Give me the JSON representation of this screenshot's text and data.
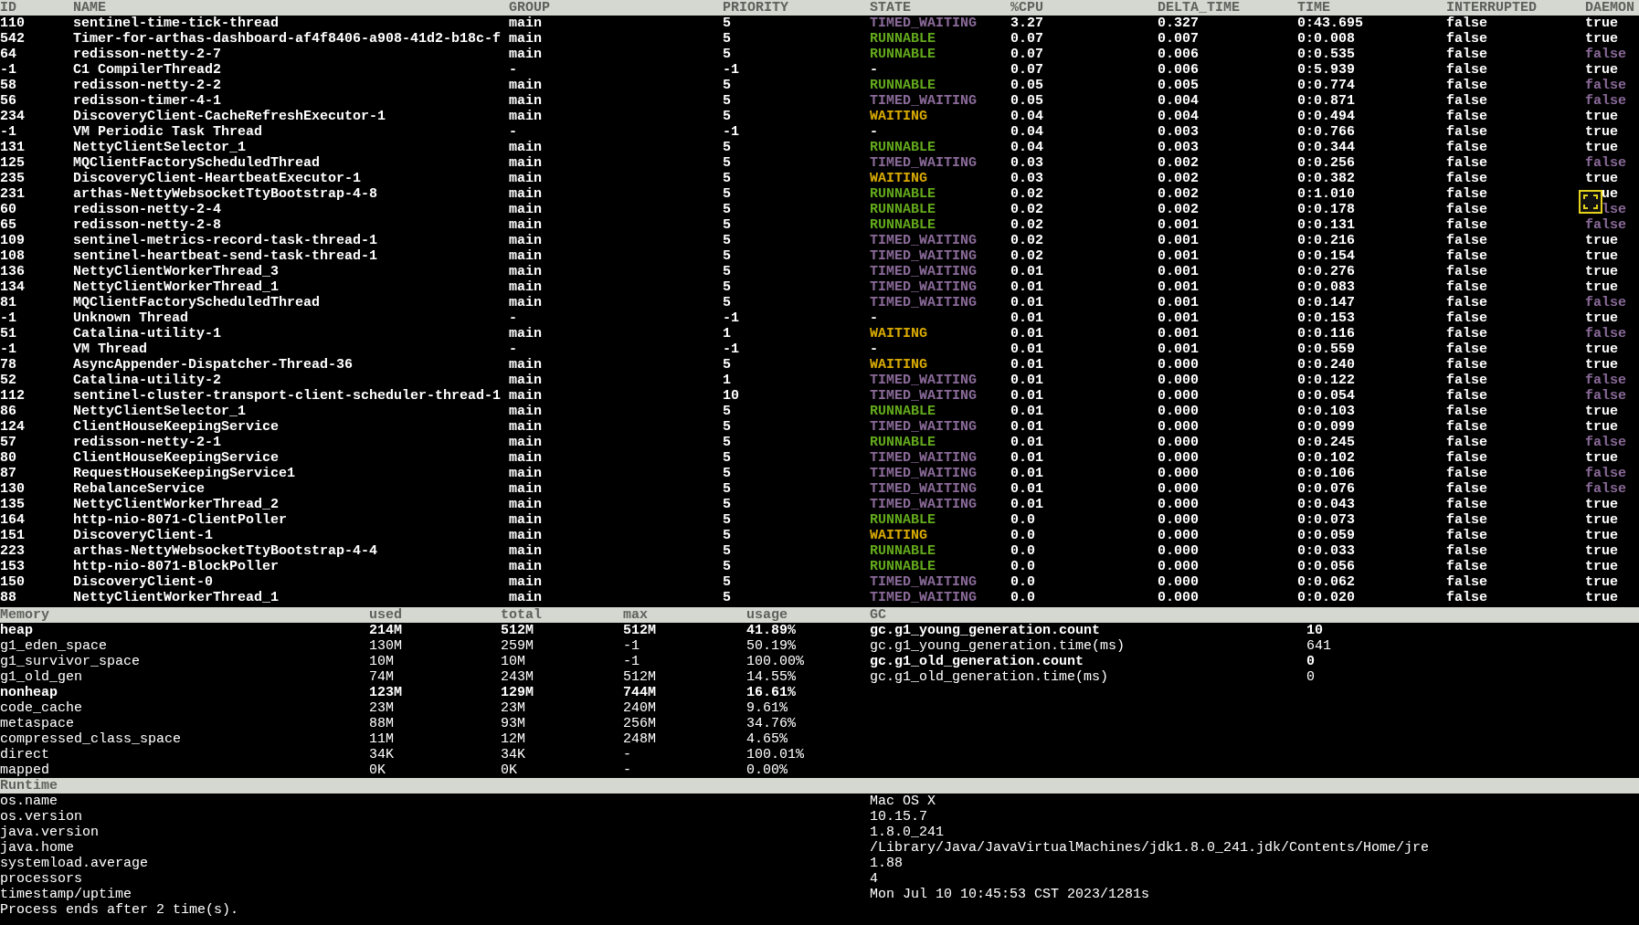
{
  "threads": {
    "columns": [
      "ID",
      "NAME",
      "GROUP",
      "PRIORITY",
      "STATE",
      "%CPU",
      "DELTA_TIME",
      "TIME",
      "INTERRUPTED",
      "DAEMON"
    ],
    "rows": [
      {
        "id": "110",
        "name": "sentinel-time-tick-thread",
        "group": "main",
        "priority": "5",
        "state": "TIMED_WAITING",
        "kind": "timed_waiting",
        "cpu": "3.27",
        "delta": "0.327",
        "time": "0:43.695",
        "interrupted": "false",
        "daemon": "true",
        "daemon_flag": true,
        "covered": false
      },
      {
        "id": "542",
        "name": "Timer-for-arthas-dashboard-af4f8406-a908-41d2-b18c-f",
        "group": "main",
        "priority": "5",
        "state": "RUNNABLE",
        "kind": "runnable",
        "cpu": "0.07",
        "delta": "0.007",
        "time": "0:0.008",
        "interrupted": "false",
        "daemon": "true",
        "daemon_flag": true,
        "covered": false
      },
      {
        "id": "64",
        "name": "redisson-netty-2-7",
        "group": "main",
        "priority": "5",
        "state": "RUNNABLE",
        "kind": "runnable",
        "cpu": "0.07",
        "delta": "0.006",
        "time": "0:0.535",
        "interrupted": "false",
        "daemon": "false",
        "daemon_flag": false,
        "covered": false
      },
      {
        "id": "-1",
        "name": "C1 CompilerThread2",
        "group": "-",
        "priority": "-1",
        "state": "-",
        "kind": "none",
        "cpu": "0.07",
        "delta": "0.006",
        "time": "0:5.939",
        "interrupted": "false",
        "daemon": "true",
        "daemon_flag": true,
        "covered": false
      },
      {
        "id": "58",
        "name": "redisson-netty-2-2",
        "group": "main",
        "priority": "5",
        "state": "RUNNABLE",
        "kind": "runnable",
        "cpu": "0.05",
        "delta": "0.005",
        "time": "0:0.774",
        "interrupted": "false",
        "daemon": "false",
        "daemon_flag": false,
        "covered": false
      },
      {
        "id": "56",
        "name": "redisson-timer-4-1",
        "group": "main",
        "priority": "5",
        "state": "TIMED_WAITING",
        "kind": "timed_waiting",
        "cpu": "0.05",
        "delta": "0.004",
        "time": "0:0.871",
        "interrupted": "false",
        "daemon": "false",
        "daemon_flag": false,
        "covered": false
      },
      {
        "id": "234",
        "name": "DiscoveryClient-CacheRefreshExecutor-1",
        "group": "main",
        "priority": "5",
        "state": "WAITING",
        "kind": "waiting",
        "cpu": "0.04",
        "delta": "0.004",
        "time": "0:0.494",
        "interrupted": "false",
        "daemon": "true",
        "daemon_flag": true,
        "covered": false
      },
      {
        "id": "-1",
        "name": "VM Periodic Task Thread",
        "group": "-",
        "priority": "-1",
        "state": "-",
        "kind": "none",
        "cpu": "0.04",
        "delta": "0.003",
        "time": "0:0.766",
        "interrupted": "false",
        "daemon": "true",
        "daemon_flag": true,
        "covered": false
      },
      {
        "id": "131",
        "name": "NettyClientSelector_1",
        "group": "main",
        "priority": "5",
        "state": "RUNNABLE",
        "kind": "runnable",
        "cpu": "0.04",
        "delta": "0.003",
        "time": "0:0.344",
        "interrupted": "false",
        "daemon": "true",
        "daemon_flag": true,
        "covered": false
      },
      {
        "id": "125",
        "name": "MQClientFactoryScheduledThread",
        "group": "main",
        "priority": "5",
        "state": "TIMED_WAITING",
        "kind": "timed_waiting",
        "cpu": "0.03",
        "delta": "0.002",
        "time": "0:0.256",
        "interrupted": "false",
        "daemon": "false",
        "daemon_flag": false,
        "covered": false
      },
      {
        "id": "235",
        "name": "DiscoveryClient-HeartbeatExecutor-1",
        "group": "main",
        "priority": "5",
        "state": "WAITING",
        "kind": "waiting",
        "cpu": "0.03",
        "delta": "0.002",
        "time": "0:0.382",
        "interrupted": "false",
        "daemon": "true",
        "daemon_flag": true,
        "covered": false
      },
      {
        "id": "231",
        "name": "arthas-NettyWebsocketTtyBootstrap-4-8",
        "group": "main",
        "priority": "5",
        "state": "RUNNABLE",
        "kind": "runnable",
        "cpu": "0.02",
        "delta": "0.002",
        "time": "0:1.010",
        "interrupted": "false",
        "daemon": "ue",
        "daemon_flag": true,
        "covered": true
      },
      {
        "id": "60",
        "name": "redisson-netty-2-4",
        "group": "main",
        "priority": "5",
        "state": "RUNNABLE",
        "kind": "runnable",
        "cpu": "0.02",
        "delta": "0.002",
        "time": "0:0.178",
        "interrupted": "false",
        "daemon": "lse",
        "daemon_flag": false,
        "covered": true
      },
      {
        "id": "65",
        "name": "redisson-netty-2-8",
        "group": "main",
        "priority": "5",
        "state": "RUNNABLE",
        "kind": "runnable",
        "cpu": "0.02",
        "delta": "0.001",
        "time": "0:0.131",
        "interrupted": "false",
        "daemon": "false",
        "daemon_flag": false,
        "covered": false
      },
      {
        "id": "109",
        "name": "sentinel-metrics-record-task-thread-1",
        "group": "main",
        "priority": "5",
        "state": "TIMED_WAITING",
        "kind": "timed_waiting",
        "cpu": "0.02",
        "delta": "0.001",
        "time": "0:0.216",
        "interrupted": "false",
        "daemon": "true",
        "daemon_flag": true,
        "covered": false
      },
      {
        "id": "108",
        "name": "sentinel-heartbeat-send-task-thread-1",
        "group": "main",
        "priority": "5",
        "state": "TIMED_WAITING",
        "kind": "timed_waiting",
        "cpu": "0.02",
        "delta": "0.001",
        "time": "0:0.154",
        "interrupted": "false",
        "daemon": "true",
        "daemon_flag": true,
        "covered": false
      },
      {
        "id": "136",
        "name": "NettyClientWorkerThread_3",
        "group": "main",
        "priority": "5",
        "state": "TIMED_WAITING",
        "kind": "timed_waiting",
        "cpu": "0.01",
        "delta": "0.001",
        "time": "0:0.276",
        "interrupted": "false",
        "daemon": "true",
        "daemon_flag": true,
        "covered": false
      },
      {
        "id": "134",
        "name": "NettyClientWorkerThread_1",
        "group": "main",
        "priority": "5",
        "state": "TIMED_WAITING",
        "kind": "timed_waiting",
        "cpu": "0.01",
        "delta": "0.001",
        "time": "0:0.083",
        "interrupted": "false",
        "daemon": "true",
        "daemon_flag": true,
        "covered": false
      },
      {
        "id": "81",
        "name": "MQClientFactoryScheduledThread",
        "group": "main",
        "priority": "5",
        "state": "TIMED_WAITING",
        "kind": "timed_waiting",
        "cpu": "0.01",
        "delta": "0.001",
        "time": "0:0.147",
        "interrupted": "false",
        "daemon": "false",
        "daemon_flag": false,
        "covered": false
      },
      {
        "id": "-1",
        "name": "Unknown Thread",
        "group": "-",
        "priority": "-1",
        "state": "-",
        "kind": "none",
        "cpu": "0.01",
        "delta": "0.001",
        "time": "0:0.153",
        "interrupted": "false",
        "daemon": "true",
        "daemon_flag": true,
        "covered": false
      },
      {
        "id": "51",
        "name": "Catalina-utility-1",
        "group": "main",
        "priority": "1",
        "state": "WAITING",
        "kind": "waiting",
        "cpu": "0.01",
        "delta": "0.001",
        "time": "0:0.116",
        "interrupted": "false",
        "daemon": "false",
        "daemon_flag": false,
        "covered": false
      },
      {
        "id": "-1",
        "name": "VM Thread",
        "group": "-",
        "priority": "-1",
        "state": "-",
        "kind": "none",
        "cpu": "0.01",
        "delta": "0.001",
        "time": "0:0.559",
        "interrupted": "false",
        "daemon": "true",
        "daemon_flag": true,
        "covered": false
      },
      {
        "id": "78",
        "name": "AsyncAppender-Dispatcher-Thread-36",
        "group": "main",
        "priority": "5",
        "state": "WAITING",
        "kind": "waiting",
        "cpu": "0.01",
        "delta": "0.000",
        "time": "0:0.240",
        "interrupted": "false",
        "daemon": "true",
        "daemon_flag": true,
        "covered": false
      },
      {
        "id": "52",
        "name": "Catalina-utility-2",
        "group": "main",
        "priority": "1",
        "state": "TIMED_WAITING",
        "kind": "timed_waiting",
        "cpu": "0.01",
        "delta": "0.000",
        "time": "0:0.122",
        "interrupted": "false",
        "daemon": "false",
        "daemon_flag": false,
        "covered": false
      },
      {
        "id": "112",
        "name": "sentinel-cluster-transport-client-scheduler-thread-1",
        "group": "main",
        "priority": "10",
        "state": "TIMED_WAITING",
        "kind": "timed_waiting",
        "cpu": "0.01",
        "delta": "0.000",
        "time": "0:0.054",
        "interrupted": "false",
        "daemon": "false",
        "daemon_flag": false,
        "covered": false
      },
      {
        "id": "86",
        "name": "NettyClientSelector_1",
        "group": "main",
        "priority": "5",
        "state": "RUNNABLE",
        "kind": "runnable",
        "cpu": "0.01",
        "delta": "0.000",
        "time": "0:0.103",
        "interrupted": "false",
        "daemon": "true",
        "daemon_flag": true,
        "covered": false
      },
      {
        "id": "124",
        "name": "ClientHouseKeepingService",
        "group": "main",
        "priority": "5",
        "state": "TIMED_WAITING",
        "kind": "timed_waiting",
        "cpu": "0.01",
        "delta": "0.000",
        "time": "0:0.099",
        "interrupted": "false",
        "daemon": "true",
        "daemon_flag": true,
        "covered": false
      },
      {
        "id": "57",
        "name": "redisson-netty-2-1",
        "group": "main",
        "priority": "5",
        "state": "RUNNABLE",
        "kind": "runnable",
        "cpu": "0.01",
        "delta": "0.000",
        "time": "0:0.245",
        "interrupted": "false",
        "daemon": "false",
        "daemon_flag": false,
        "covered": false
      },
      {
        "id": "80",
        "name": "ClientHouseKeepingService",
        "group": "main",
        "priority": "5",
        "state": "TIMED_WAITING",
        "kind": "timed_waiting",
        "cpu": "0.01",
        "delta": "0.000",
        "time": "0:0.102",
        "interrupted": "false",
        "daemon": "true",
        "daemon_flag": true,
        "covered": false
      },
      {
        "id": "87",
        "name": "RequestHouseKeepingService1",
        "group": "main",
        "priority": "5",
        "state": "TIMED_WAITING",
        "kind": "timed_waiting",
        "cpu": "0.01",
        "delta": "0.000",
        "time": "0:0.106",
        "interrupted": "false",
        "daemon": "false",
        "daemon_flag": false,
        "covered": false
      },
      {
        "id": "130",
        "name": "RebalanceService",
        "group": "main",
        "priority": "5",
        "state": "TIMED_WAITING",
        "kind": "timed_waiting",
        "cpu": "0.01",
        "delta": "0.000",
        "time": "0:0.076",
        "interrupted": "false",
        "daemon": "false",
        "daemon_flag": false,
        "covered": false
      },
      {
        "id": "135",
        "name": "NettyClientWorkerThread_2",
        "group": "main",
        "priority": "5",
        "state": "TIMED_WAITING",
        "kind": "timed_waiting",
        "cpu": "0.01",
        "delta": "0.000",
        "time": "0:0.043",
        "interrupted": "false",
        "daemon": "true",
        "daemon_flag": true,
        "covered": false
      },
      {
        "id": "164",
        "name": "http-nio-8071-ClientPoller",
        "group": "main",
        "priority": "5",
        "state": "RUNNABLE",
        "kind": "runnable",
        "cpu": "0.0",
        "delta": "0.000",
        "time": "0:0.073",
        "interrupted": "false",
        "daemon": "true",
        "daemon_flag": true,
        "covered": false
      },
      {
        "id": "151",
        "name": "DiscoveryClient-1",
        "group": "main",
        "priority": "5",
        "state": "WAITING",
        "kind": "waiting",
        "cpu": "0.0",
        "delta": "0.000",
        "time": "0:0.059",
        "interrupted": "false",
        "daemon": "true",
        "daemon_flag": true,
        "covered": false
      },
      {
        "id": "223",
        "name": "arthas-NettyWebsocketTtyBootstrap-4-4",
        "group": "main",
        "priority": "5",
        "state": "RUNNABLE",
        "kind": "runnable",
        "cpu": "0.0",
        "delta": "0.000",
        "time": "0:0.033",
        "interrupted": "false",
        "daemon": "true",
        "daemon_flag": true,
        "covered": false
      },
      {
        "id": "153",
        "name": "http-nio-8071-BlockPoller",
        "group": "main",
        "priority": "5",
        "state": "RUNNABLE",
        "kind": "runnable",
        "cpu": "0.0",
        "delta": "0.000",
        "time": "0:0.056",
        "interrupted": "false",
        "daemon": "true",
        "daemon_flag": true,
        "covered": false
      },
      {
        "id": "150",
        "name": "DiscoveryClient-0",
        "group": "main",
        "priority": "5",
        "state": "TIMED_WAITING",
        "kind": "timed_waiting",
        "cpu": "0.0",
        "delta": "0.000",
        "time": "0:0.062",
        "interrupted": "false",
        "daemon": "true",
        "daemon_flag": true,
        "covered": false
      },
      {
        "id": "88",
        "name": "NettyClientWorkerThread_1",
        "group": "main",
        "priority": "5",
        "state": "TIMED_WAITING",
        "kind": "timed_waiting",
        "cpu": "0.0",
        "delta": "0.000",
        "time": "0:0.020",
        "interrupted": "false",
        "daemon": "true",
        "daemon_flag": true,
        "covered": false
      }
    ]
  },
  "memory": {
    "columns": [
      "Memory",
      "used",
      "total",
      "max",
      "usage"
    ],
    "rows": [
      {
        "name": "heap",
        "used": "214M",
        "total": "512M",
        "max": "512M",
        "usage": "41.89%",
        "bold": true
      },
      {
        "name": "g1_eden_space",
        "used": "130M",
        "total": "259M",
        "max": "-1",
        "usage": "50.19%",
        "bold": false
      },
      {
        "name": "g1_survivor_space",
        "used": "10M",
        "total": "10M",
        "max": "-1",
        "usage": "100.00%",
        "bold": false
      },
      {
        "name": "g1_old_gen",
        "used": "74M",
        "total": "243M",
        "max": "512M",
        "usage": "14.55%",
        "bold": false
      },
      {
        "name": "nonheap",
        "used": "123M",
        "total": "129M",
        "max": "744M",
        "usage": "16.61%",
        "bold": true
      },
      {
        "name": "code_cache",
        "used": "23M",
        "total": "23M",
        "max": "240M",
        "usage": "9.61%",
        "bold": false
      },
      {
        "name": "metaspace",
        "used": "88M",
        "total": "93M",
        "max": "256M",
        "usage": "34.76%",
        "bold": false
      },
      {
        "name": "compressed_class_space",
        "used": "11M",
        "total": "12M",
        "max": "248M",
        "usage": "4.65%",
        "bold": false
      },
      {
        "name": "direct",
        "used": "34K",
        "total": "34K",
        "max": "-",
        "usage": "100.01%",
        "bold": false
      },
      {
        "name": "mapped",
        "used": "0K",
        "total": "0K",
        "max": "-",
        "usage": "0.00%",
        "bold": false
      }
    ]
  },
  "gc": {
    "title": "GC",
    "rows": [
      {
        "name": "gc.g1_young_generation.count",
        "value": "10",
        "bold": true
      },
      {
        "name": "gc.g1_young_generation.time(ms)",
        "value": "641",
        "bold": false
      },
      {
        "name": "gc.g1_old_generation.count",
        "value": "0",
        "bold": true
      },
      {
        "name": "gc.g1_old_generation.time(ms)",
        "value": "0",
        "bold": false
      }
    ]
  },
  "runtime": {
    "title": "Runtime",
    "rows": [
      {
        "name": "os.name",
        "value": "Mac OS X"
      },
      {
        "name": "os.version",
        "value": "10.15.7"
      },
      {
        "name": "java.version",
        "value": "1.8.0_241"
      },
      {
        "name": "java.home",
        "value": "/Library/Java/JavaVirtualMachines/jdk1.8.0_241.jdk/Contents/Home/jre"
      },
      {
        "name": "systemload.average",
        "value": "1.88"
      },
      {
        "name": "processors",
        "value": "4"
      },
      {
        "name": "timestamp/uptime",
        "value": "Mon Jul 10 10:45:53 CST 2023/1281s"
      }
    ]
  },
  "footer": "Process ends after 2 time(s)."
}
